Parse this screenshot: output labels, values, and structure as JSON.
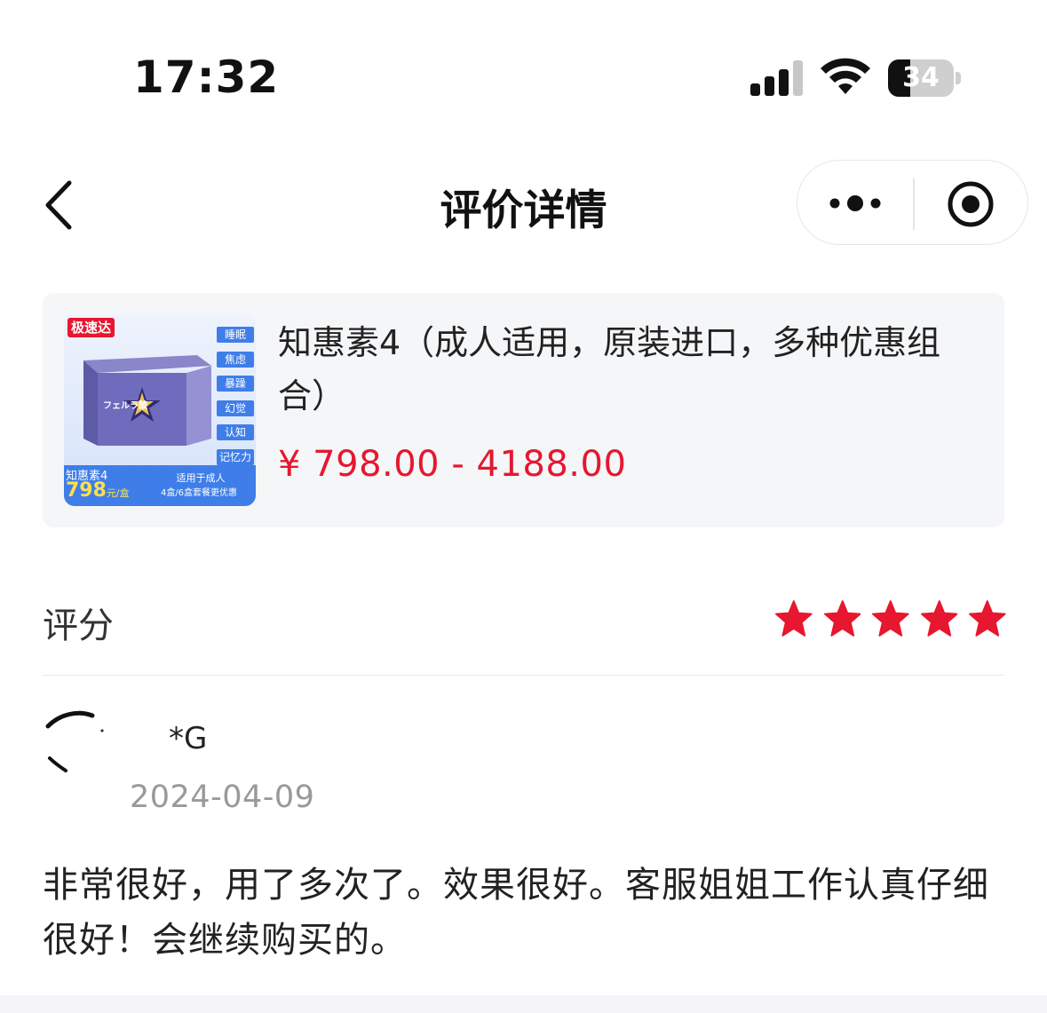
{
  "status_bar": {
    "time": "17:32",
    "battery_percent": "34",
    "battery_level": 0.34,
    "icons": [
      "signal-icon",
      "wifi-icon",
      "battery-icon"
    ]
  },
  "nav": {
    "title": "评价详情",
    "icons": [
      "back-icon",
      "more-dots-icon",
      "target-icon"
    ]
  },
  "product": {
    "name": "知惠素4（成人适用，原装进口，多种优惠组合）",
    "price": "¥ 798.00 - 4188.00",
    "thumbnail": {
      "badge": "极速达",
      "tags": [
        "睡眠",
        "焦虑",
        "暴躁",
        "幻觉",
        "认知",
        "记忆力"
      ],
      "brand_line": "知惠素4",
      "price_big": "798",
      "price_unit": "元/盒",
      "footer_line1": "适用于成人",
      "footer_line2": "4盒/6盒套餐更优惠",
      "box_label": "フェルラ酸"
    }
  },
  "rating": {
    "label": "评分",
    "stars": 5,
    "star_color": "#e6172f"
  },
  "review": {
    "user": "*G",
    "date": "2024-04-09",
    "text": "非常很好，用了多次了。效果很好。客服姐姐工作认真仔细很好！会继续购买的。"
  },
  "colors": {
    "accent_red": "#e6172f",
    "card_bg": "#f5f6f8",
    "muted_text": "#999999"
  }
}
